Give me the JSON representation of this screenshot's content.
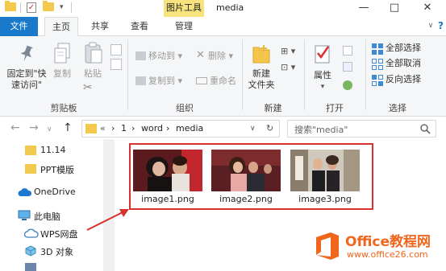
{
  "titlebar": {
    "window_title": "media",
    "context_tab": "图片工具",
    "minimize": "—",
    "maximize": "□",
    "close": "✕"
  },
  "tabs": {
    "file": "文件",
    "home": "主页",
    "share": "共享",
    "view": "查看",
    "manage": "管理"
  },
  "ribbon": {
    "clipboard": {
      "pin_line1": "固定到\"快",
      "pin_line2": "速访问\"",
      "copy": "复制",
      "paste": "粘贴",
      "label": "剪贴板"
    },
    "organize": {
      "move_to": "移动到",
      "copy_to": "复制到",
      "delete": "删除",
      "rename": "重命名",
      "label": "组织"
    },
    "new": {
      "new_folder_line1": "新建",
      "new_folder_line2": "文件夹",
      "label": "新建"
    },
    "open": {
      "properties": "属性",
      "label": "打开"
    },
    "select": {
      "select_all": "全部选择",
      "select_none": "全部取消",
      "invert": "反向选择",
      "label": "选择"
    }
  },
  "address": {
    "chevron": "«",
    "crumbs": [
      "1",
      "word",
      "media"
    ],
    "search_placeholder": "搜索\"media\""
  },
  "navpane": {
    "items": [
      "11.14",
      "PPT模版",
      "OneDrive",
      "此电脑",
      "WPS网盘",
      "3D 对象"
    ]
  },
  "files": [
    "image1.png",
    "image2.png",
    "image3.png"
  ],
  "watermark": {
    "brand": "Office教程网",
    "url": "www.office26.com"
  },
  "colors": {
    "file_tab": "#1979ca",
    "context_tab": "#f7e37e",
    "highlight": "#d9312f",
    "watermark_orange": "#f0661d"
  }
}
